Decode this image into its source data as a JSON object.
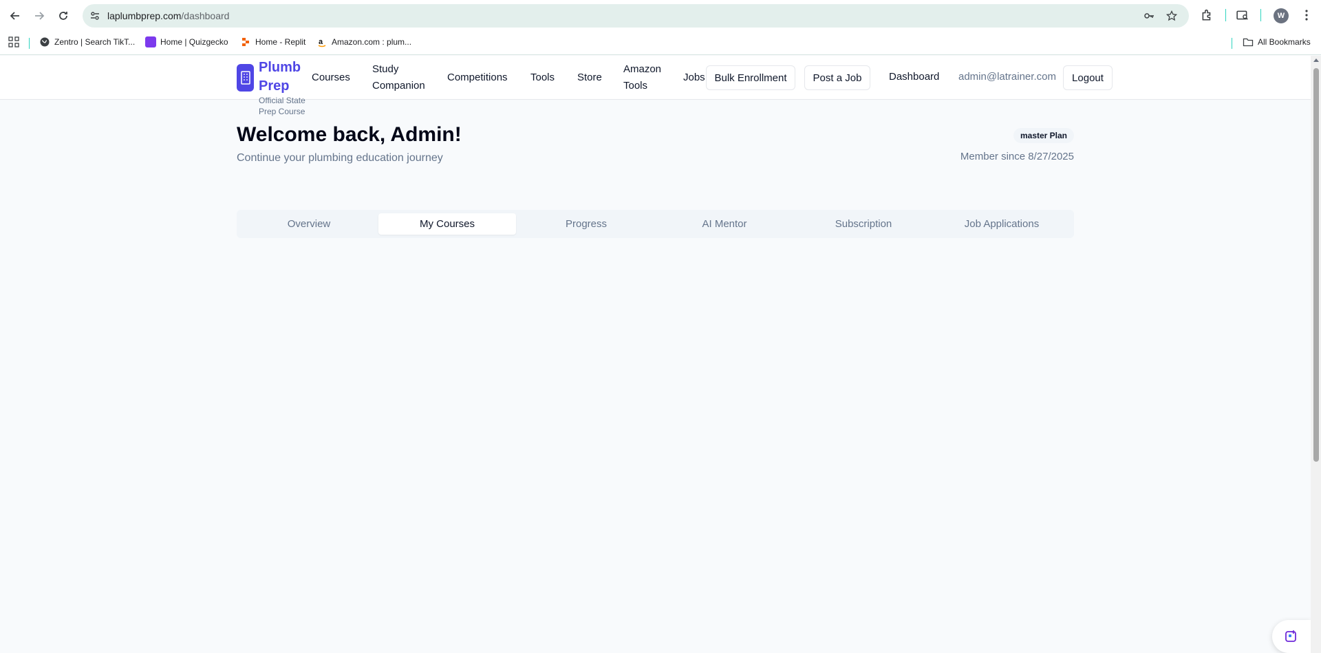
{
  "browser": {
    "url_host": "laplumbprep.com",
    "url_path": "/dashboard",
    "profile_initial": "W",
    "bookmarks": [
      {
        "label": "Zentro | Search TikT...",
        "icon": "globe-icon"
      },
      {
        "label": "Home | Quizgecko",
        "icon": "quizgecko-icon"
      },
      {
        "label": "Home - Replit",
        "icon": "replit-icon"
      },
      {
        "label": "Amazon.com : plum...",
        "icon": "amazon-icon"
      }
    ],
    "all_bookmarks_label": "All Bookmarks"
  },
  "header": {
    "logo_title": "Plumb Prep",
    "logo_subtitle": "Official State Prep Course",
    "nav": [
      "Courses",
      "Study Companion",
      "Competitions",
      "Tools",
      "Store",
      "Amazon Tools",
      "Jobs"
    ],
    "bulk_enrollment": "Bulk Enrollment",
    "post_job": "Post a Job",
    "dashboard": "Dashboard",
    "email": "admin@latrainer.com",
    "logout": "Logout"
  },
  "main": {
    "welcome": "Welcome back, Admin!",
    "subtitle": "Continue your plumbing education journey",
    "plan_badge": "master Plan",
    "member_since": "Member since 8/27/2025",
    "tabs": [
      "Overview",
      "My Courses",
      "Progress",
      "AI Mentor",
      "Subscription",
      "Job Applications"
    ],
    "active_tab": "My Courses"
  },
  "colors": {
    "brand": "#4f46e5",
    "background": "#f8fafc",
    "muted_text": "#64748b"
  }
}
